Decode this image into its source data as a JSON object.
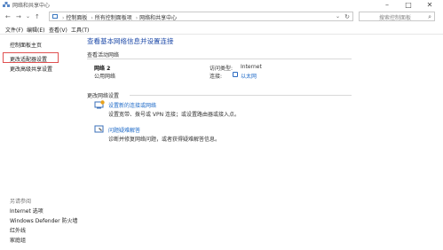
{
  "window": {
    "title": "网络和共享中心"
  },
  "nav": {
    "breadcrumbs": [
      "控制面板",
      "所有控制面板项",
      "网络和共享中心"
    ],
    "search_placeholder": "搜索控制面板"
  },
  "menu": [
    "文件(F)",
    "编辑(E)",
    "查看(V)",
    "工具(T)"
  ],
  "sidebar": {
    "top_links": [
      "控制面板主页",
      "更改适配器设置",
      "更改高级共享设置"
    ],
    "see_also_title": "另请参阅",
    "see_also_links": [
      "Internet 选项",
      "Windows Defender 防火墙",
      "红外线",
      "家庭组"
    ]
  },
  "main": {
    "title": "查看基本网络信息并设置连接",
    "active_section": "查看活动网络",
    "network": {
      "name": "网络 2",
      "type": "公用网络",
      "access_label": "访问类型:",
      "access_value": "Internet",
      "conn_label": "连接:",
      "conn_value": "以太网"
    },
    "change_section": "更改网络设置",
    "tasks": [
      {
        "title": "设置新的连接或网络",
        "desc": "设置宽带、拨号或 VPN 连接；或设置路由器或接入点。"
      },
      {
        "title": "问题疑难解答",
        "desc": "诊断并修复网络问题，或者获得疑难解答信息。"
      }
    ]
  },
  "colors": {
    "accent": "#1e6ac8",
    "highlight_border": "#e05050"
  }
}
